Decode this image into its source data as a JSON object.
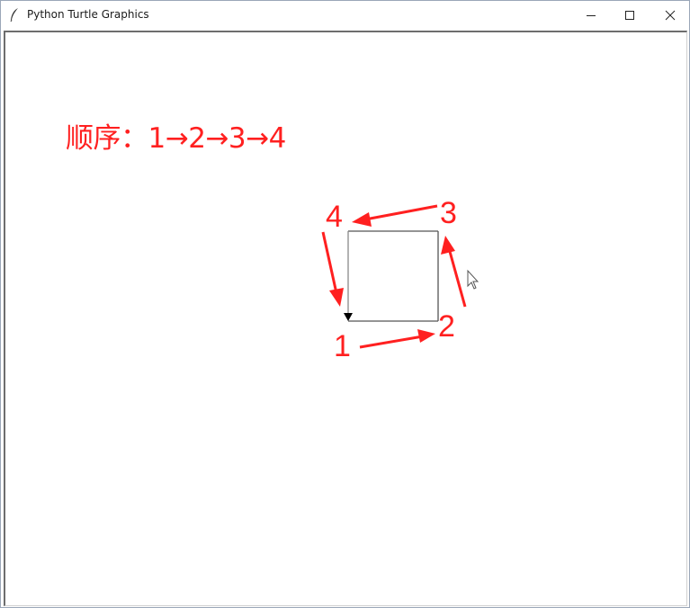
{
  "window": {
    "title": "Python Turtle Graphics",
    "icon": "feather-icon",
    "controls": {
      "minimize": "minimize-icon",
      "maximize": "maximize-icon",
      "close": "close-icon"
    }
  },
  "annotation": {
    "order_text": "顺序：1→2→3→4",
    "color": "#ff2020",
    "labels": [
      "1",
      "2",
      "3",
      "4"
    ]
  },
  "drawing": {
    "shape": "square",
    "line_color": "#555555",
    "turtle_color": "#000000"
  }
}
